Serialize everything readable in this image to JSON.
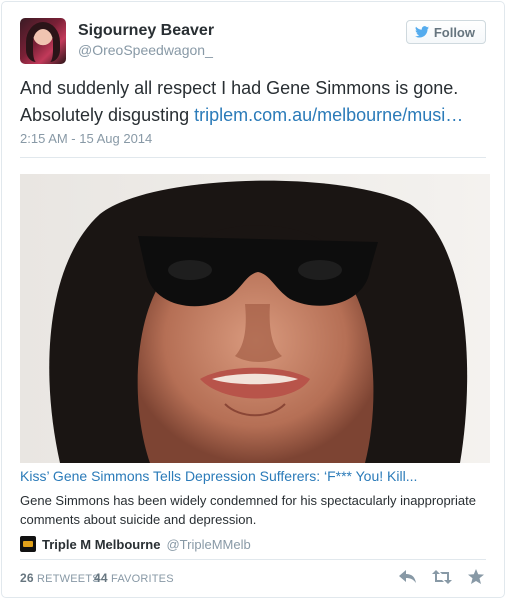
{
  "user": {
    "name": "Sigourney Beaver",
    "handle": "@OreoSpeedwagon_"
  },
  "follow_button": {
    "label": "Follow",
    "icon": "twitter-bird-icon"
  },
  "tweet": {
    "text": "And suddenly all respect I had Gene Simmons is gone. Absolutely disgusting ",
    "link": "triplem.com.au/melbourne/musi…",
    "timestamp": "2:15 AM - 15 Aug 2014"
  },
  "card": {
    "title": "Kiss’ Gene Simmons Tells Depression Sufferers: ‘F*** You! Kill...",
    "description": "Gene Simmons has been widely condemned for his spectacularly inappropriate comments about suicide and depression.",
    "source_name": "Triple M Melbourne",
    "source_handle": "@TripleMMelb"
  },
  "stats": {
    "retweets_count": "26",
    "retweets_label": "RETWEETS",
    "favorites_count": "44",
    "favorites_label": "FAVORITES"
  },
  "actions": [
    "reply-icon",
    "retweet-icon",
    "favorite-icon"
  ],
  "colors": {
    "link": "#2b7bb9",
    "muted": "#8899a6",
    "text": "#292f33",
    "twitter_blue": "#55acee"
  }
}
